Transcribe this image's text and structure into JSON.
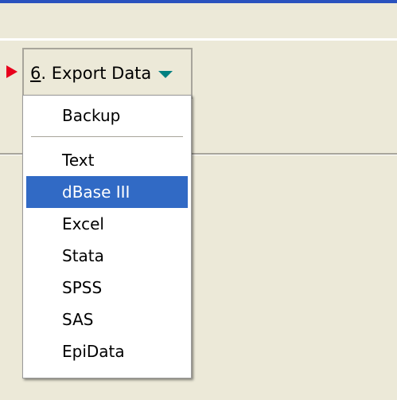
{
  "export_button": {
    "mnemonic": "6",
    "label_rest": ". Export Data"
  },
  "menu": {
    "items": [
      {
        "label": "Backup"
      },
      {
        "label": "Text"
      },
      {
        "label": "dBase III",
        "selected": true
      },
      {
        "label": "Excel"
      },
      {
        "label": "Stata"
      },
      {
        "label": "SPSS"
      },
      {
        "label": "SAS"
      },
      {
        "label": "EpiData"
      }
    ]
  },
  "colors": {
    "accent": "#316ac5",
    "arrow": "#e8001c",
    "dropdown_arrow": "#008080"
  }
}
